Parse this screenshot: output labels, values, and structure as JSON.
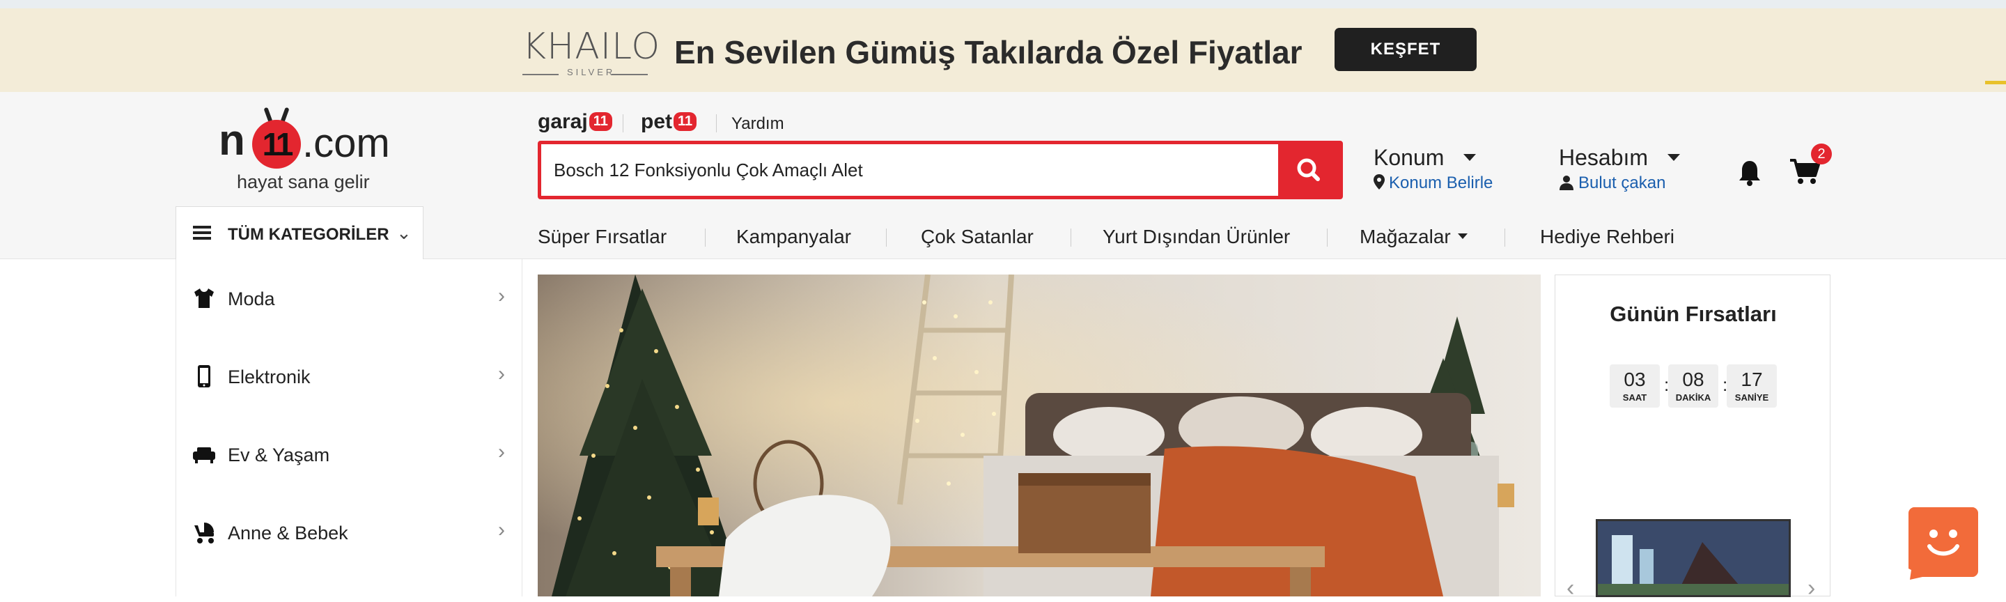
{
  "promo": {
    "brand": "KHAILO",
    "brand_sub": "SILVER",
    "title": "En Sevilen Gümüş Takılarda Özel Fiyatlar",
    "button": "KEŞFET"
  },
  "logo": {
    "n": "n",
    "eleven": "11",
    "com": ".com",
    "tagline": "hayat sana gelir"
  },
  "quicklinks": {
    "garaj": "garaj",
    "garaj_badge": "11",
    "pet": "pet",
    "pet_badge": "11",
    "help": "Yardım"
  },
  "search": {
    "value": "Bosch 12 Fonksiyonlu Çok Amaçlı Alet"
  },
  "location": {
    "title": "Konum",
    "sub": "Konum Belirle"
  },
  "account": {
    "title": "Hesabım",
    "sub": "Bulut çakan"
  },
  "cart": {
    "count": "2"
  },
  "all_categories": "TÜM KATEGORİLER",
  "nav": [
    "Süper Fırsatlar",
    "Kampanyalar",
    "Çok Satanlar",
    "Yurt Dışından Ürünler",
    "Mağazalar",
    "Hediye Rehberi"
  ],
  "categories": [
    {
      "label": "Moda",
      "icon": "tshirt-icon"
    },
    {
      "label": "Elektronik",
      "icon": "phone-icon"
    },
    {
      "label": "Ev & Yaşam",
      "icon": "sofa-icon"
    },
    {
      "label": "Anne & Bebek",
      "icon": "stroller-icon"
    }
  ],
  "deals": {
    "title": "Günün Fırsatları",
    "timer": [
      {
        "value": "03",
        "unit": "SAAT"
      },
      {
        "value": "08",
        "unit": "DAKİKA"
      },
      {
        "value": "17",
        "unit": "SANİYE"
      }
    ]
  },
  "colors": {
    "brand_red": "#e3262f",
    "promo_bg": "#f3ecd8",
    "link_blue": "#1b5fae"
  }
}
